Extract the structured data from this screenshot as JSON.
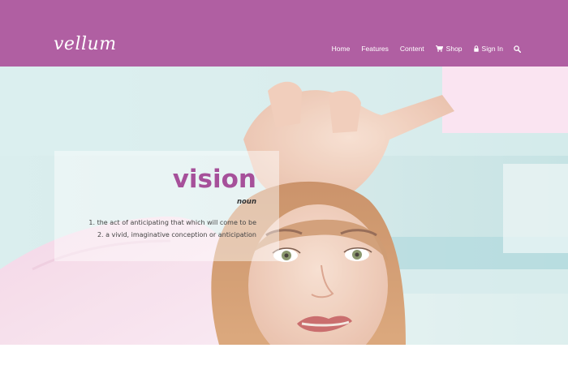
{
  "brand": {
    "logo_text": "vellum"
  },
  "nav": {
    "items": [
      {
        "label": "Home",
        "icon": ""
      },
      {
        "label": "Features",
        "icon": ""
      },
      {
        "label": "Content",
        "icon": ""
      },
      {
        "label": "Shop",
        "icon": "cart-icon"
      },
      {
        "label": "Sign In",
        "icon": "lock-icon"
      }
    ],
    "search_icon": "search-icon"
  },
  "hero": {
    "term": "vision",
    "part_of_speech": "noun",
    "definitions": [
      "1. the act of anticipating that which will come to be",
      "2. a vivid, imaginative conception or anticipation"
    ]
  },
  "colors": {
    "header_bg": "#b05fa2",
    "term_color": "#a6509a"
  }
}
